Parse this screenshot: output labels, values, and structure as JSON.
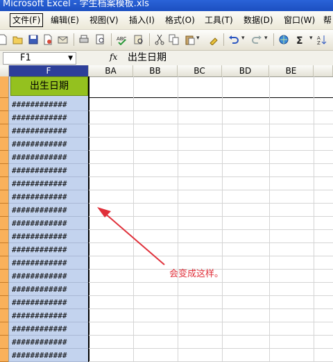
{
  "window": {
    "title": "Microsoft Excel - 学生档案模板.xls"
  },
  "menu": [
    {
      "label": "文件(F)",
      "active": true
    },
    {
      "label": "编辑(E)"
    },
    {
      "label": "视图(V)"
    },
    {
      "label": "插入(I)"
    },
    {
      "label": "格式(O)"
    },
    {
      "label": "工具(T)"
    },
    {
      "label": "数据(D)"
    },
    {
      "label": "窗口(W)"
    },
    {
      "label": "帮"
    }
  ],
  "formula_bar": {
    "name_box": "F1",
    "fx": "fx",
    "value": "出生日期"
  },
  "columns": [
    "F",
    "BA",
    "BB",
    "BC",
    "BD",
    "BE"
  ],
  "header_cell": "出生日期",
  "overflow_cell": "############",
  "annotation": "会变成这样。",
  "colors": {
    "selected_column": "#c3d3ee",
    "header_fill": "#94c11f",
    "row_headers": "#f9b15b",
    "annotation": "#e0303a"
  }
}
